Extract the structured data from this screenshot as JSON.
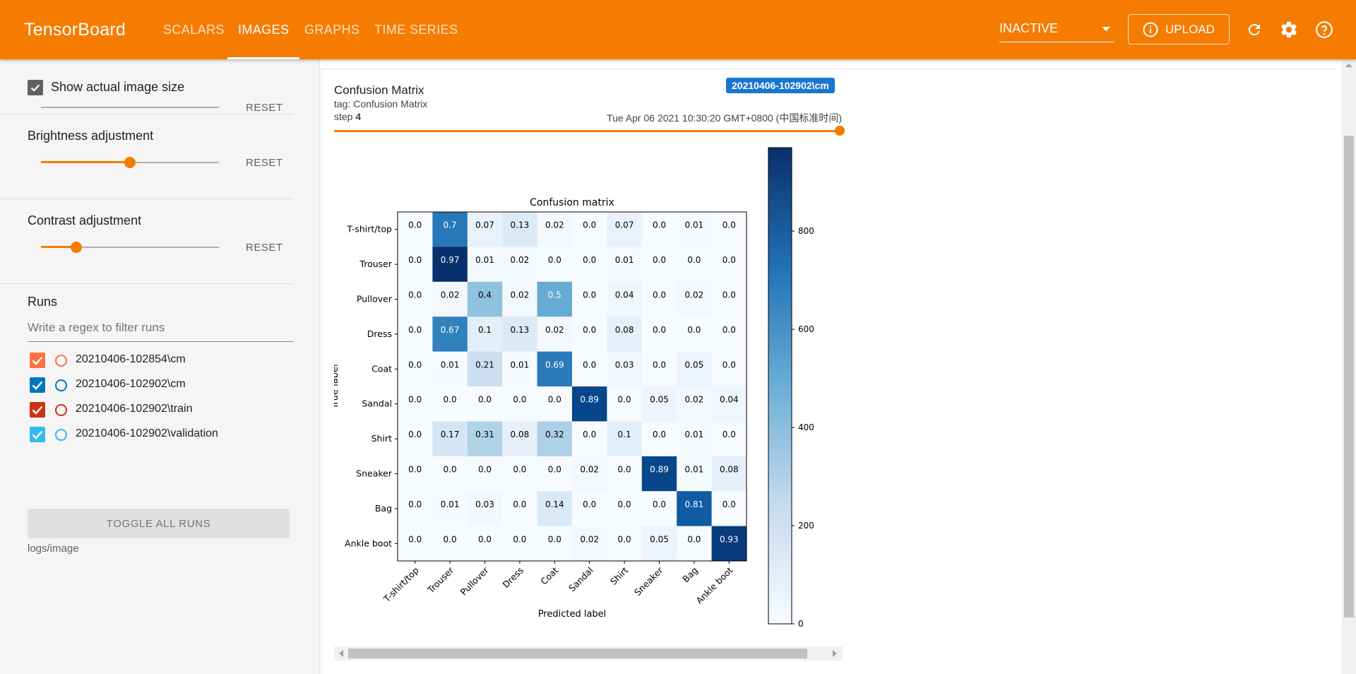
{
  "header": {
    "brand": "TensorBoard",
    "tabs": [
      {
        "label": "SCALARS",
        "active": false
      },
      {
        "label": "IMAGES",
        "active": true
      },
      {
        "label": "GRAPHS",
        "active": false
      },
      {
        "label": "TIME SERIES",
        "active": false
      }
    ],
    "inactive_select": "INACTIVE",
    "upload_label": "UPLOAD",
    "icons": [
      "refresh-icon",
      "settings-icon",
      "help-icon"
    ]
  },
  "sidebar": {
    "show_actual_size_label": "Show actual image size",
    "show_actual_size_checked": true,
    "brightness": {
      "label": "Brightness adjustment",
      "reset": "RESET",
      "level": 0.5
    },
    "contrast": {
      "label": "Contrast adjustment",
      "reset": "RESET",
      "level": 0.2
    },
    "runs_title": "Runs",
    "filter_placeholder": "Write a regex to filter runs",
    "runs": [
      {
        "name": "20210406-102854\\cm",
        "checked": true,
        "color": "#ff7043"
      },
      {
        "name": "20210406-102902\\cm",
        "checked": true,
        "color": "#0077bb"
      },
      {
        "name": "20210406-102902\\train",
        "checked": true,
        "color": "#cc3311"
      },
      {
        "name": "20210406-102902\\validation",
        "checked": true,
        "color": "#33bbee"
      }
    ],
    "toggle_all": "TOGGLE ALL RUNS",
    "logs_path": "logs/image"
  },
  "card": {
    "title": "Confusion Matrix",
    "tag": "tag: Confusion Matrix",
    "step_label": "step",
    "step_value": "4",
    "run_chip": "20210406-102902\\cm",
    "timestamp": "Tue Apr 06 2021 10:30:20 GMT+0800 (中国标准时间)",
    "accent": "#f57c00",
    "chip_color": "#1976d2"
  },
  "chart_data": {
    "type": "heatmap",
    "title": "Confusion matrix",
    "xlabel": "Predicted label",
    "ylabel": "True label",
    "classes": [
      "T-shirt/top",
      "Trouser",
      "Pullover",
      "Dress",
      "Coat",
      "Sandal",
      "Shirt",
      "Sneaker",
      "Bag",
      "Ankle boot"
    ],
    "matrix": [
      [
        0.0,
        0.7,
        0.07,
        0.13,
        0.02,
        0.0,
        0.07,
        0.0,
        0.01,
        0.0
      ],
      [
        0.0,
        0.97,
        0.01,
        0.02,
        0.0,
        0.0,
        0.01,
        0.0,
        0.0,
        0.0
      ],
      [
        0.0,
        0.02,
        0.4,
        0.02,
        0.5,
        0.0,
        0.04,
        0.0,
        0.02,
        0.0
      ],
      [
        0.0,
        0.67,
        0.1,
        0.13,
        0.02,
        0.0,
        0.08,
        0.0,
        0.0,
        0.0
      ],
      [
        0.0,
        0.01,
        0.21,
        0.01,
        0.69,
        0.0,
        0.03,
        0.0,
        0.05,
        0.0
      ],
      [
        0.0,
        0.0,
        0.0,
        0.0,
        0.0,
        0.89,
        0.0,
        0.05,
        0.02,
        0.04
      ],
      [
        0.0,
        0.17,
        0.31,
        0.08,
        0.32,
        0.0,
        0.1,
        0.0,
        0.01,
        0.0
      ],
      [
        0.0,
        0.0,
        0.0,
        0.0,
        0.0,
        0.02,
        0.0,
        0.89,
        0.01,
        0.08
      ],
      [
        0.0,
        0.01,
        0.03,
        0.0,
        0.14,
        0.0,
        0.0,
        0.0,
        0.81,
        0.0
      ],
      [
        0.0,
        0.0,
        0.0,
        0.0,
        0.0,
        0.02,
        0.0,
        0.05,
        0.0,
        0.93
      ]
    ],
    "colorbar": {
      "ticks": [
        0,
        200,
        400,
        600,
        800
      ],
      "range": [
        0,
        970
      ],
      "colormap": "Blues"
    }
  }
}
